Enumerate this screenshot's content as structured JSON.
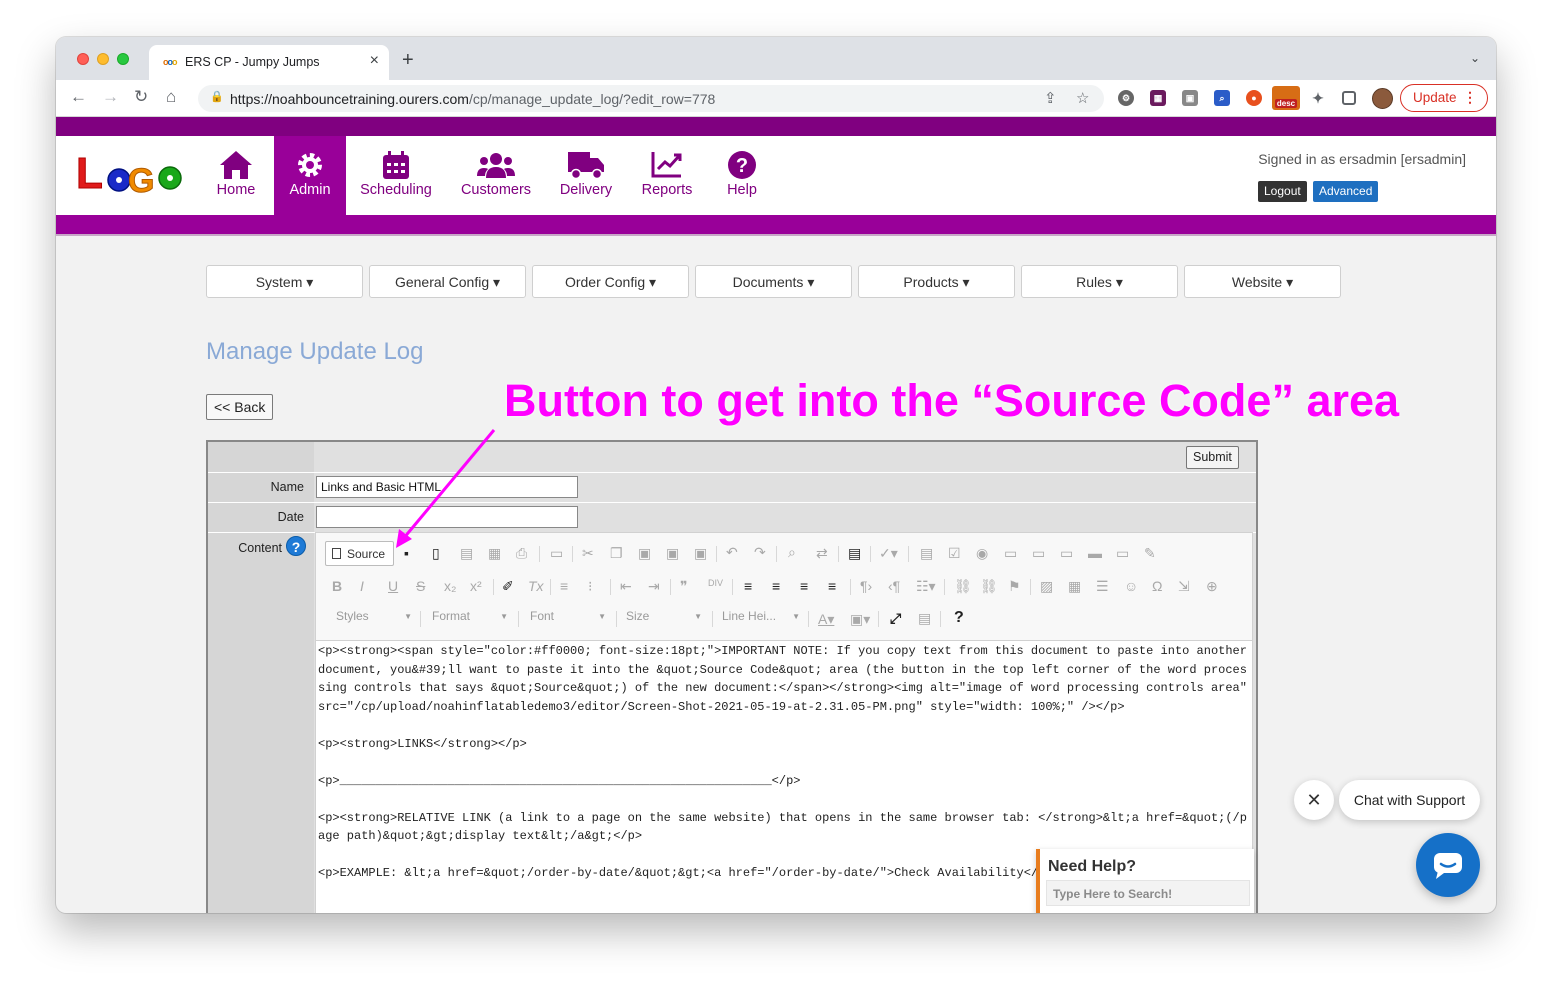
{
  "browser": {
    "tab_title": "ERS CP - Jumpy Jumps",
    "tab_close": "×",
    "new_tab": "+",
    "url_host": "https://noahbouncetraining.ourers.com",
    "url_path": "/cp/manage_update_log/?edit_row=778",
    "update_label": "Update",
    "extension_badge": "desc"
  },
  "site": {
    "logo_text": "LoGo",
    "nav": [
      {
        "label": "Home",
        "icon": "home-icon"
      },
      {
        "label": "Admin",
        "icon": "gear-icon",
        "active": true
      },
      {
        "label": "Scheduling",
        "icon": "calendar-icon"
      },
      {
        "label": "Customers",
        "icon": "users-icon"
      },
      {
        "label": "Delivery",
        "icon": "truck-icon"
      },
      {
        "label": "Reports",
        "icon": "chart-icon"
      },
      {
        "label": "Help",
        "icon": "question-icon"
      }
    ],
    "signed_in": "Signed in as ersadmin [ersadmin]",
    "logout_label": "Logout",
    "advanced_label": "Advanced"
  },
  "submenu": [
    "System ▾",
    "General Config ▾",
    "Order Config ▾",
    "Documents ▾",
    "Products ▾",
    "Rules ▾",
    "Website ▾"
  ],
  "page": {
    "title": "Manage Update Log",
    "back_label": "<< Back",
    "annotation": "Button to get into the “Source Code” area"
  },
  "form": {
    "submit_label": "Submit",
    "name_label": "Name",
    "name_value": "Links and Basic HTML",
    "date_label": "Date",
    "date_value": "",
    "content_label": "Content",
    "help_glyph": "?"
  },
  "editor": {
    "source_label": "Source",
    "combos": [
      "Styles",
      "Format",
      "Font",
      "Size",
      "Line Hei..."
    ],
    "help_glyph": "?",
    "content": [
      "<p><strong><span style=\"color:#ff0000; font-size:18pt;\">IMPORTANT NOTE: If you copy text from this document to paste into another document, you&#39;ll want to paste it into the &quot;Source Code&quot; area (the button in the top left corner of the word processing controls that says &quot;Source&quot;) of the new document:</span></strong><img alt=\"image of word processing controls area\" src=\"/cp/upload/noahinflatabledemo3/editor/Screen-Shot-2021-05-19-at-2.31.05-PM.png\" style=\"width: 100%;\" /></p>",
      "<p><strong>LINKS</strong></p>",
      "<p>____________________________________________________________</p>",
      "<p><strong>RELATIVE LINK (a link to a page on the same website) that opens in the same browser tab: </strong>&lt;a href=&quot;(/page path)&quot;&gt;display text&lt;/a&gt;</p>",
      "<p>EXAMPLE: &lt;a href=&quot;/order-by-date/&quot;&gt;<a href=\"/order-by-date/\">Check Availability</a>"
    ]
  },
  "help_widget": {
    "title": "Need Help?",
    "search_placeholder": "Type Here to Search!",
    "chat_label": "Chat with Support",
    "close_glyph": "✕"
  },
  "colors": {
    "brand_purple": "#800080",
    "brand_purple_light": "#990099",
    "title_blue": "#8aa9d6",
    "annotation_magenta": "#ff00ff",
    "chat_blue": "#1570c8"
  }
}
